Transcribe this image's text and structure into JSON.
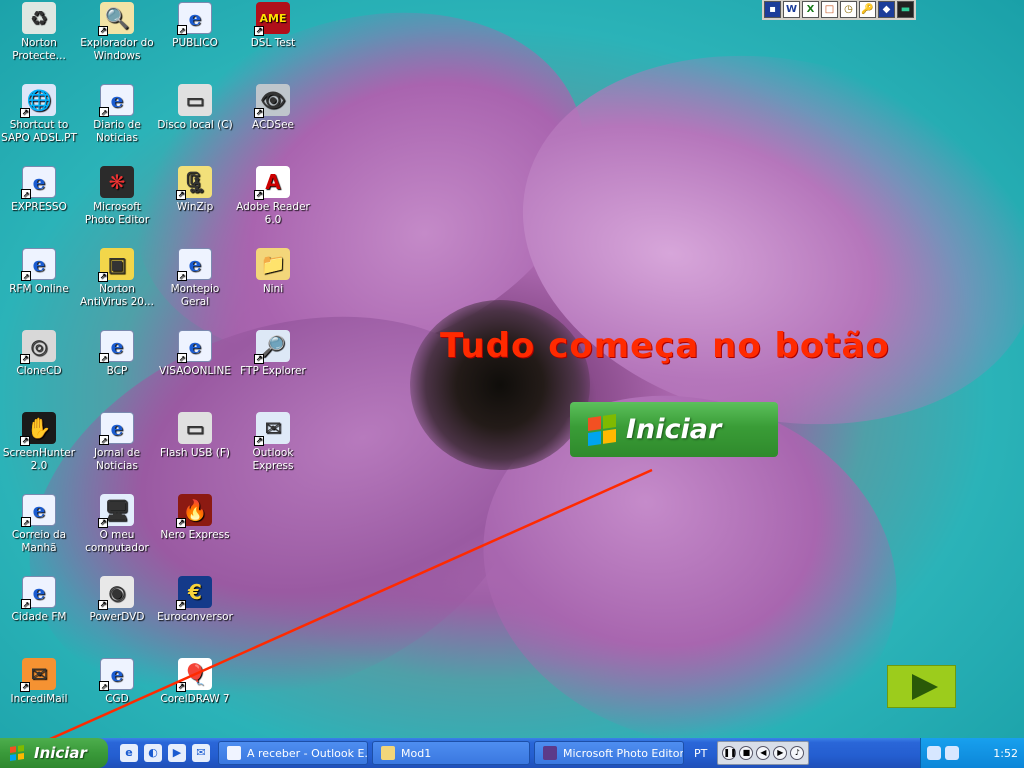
{
  "desktop": {
    "icons": [
      {
        "label": "Norton Protecte...",
        "glyph": "♻",
        "kind": "recycle"
      },
      {
        "label": "Shortcut to SAPO ADSL.PT",
        "glyph": "🌐",
        "kind": "network"
      },
      {
        "label": "EXPRESSO",
        "glyph": "e",
        "kind": "ie"
      },
      {
        "label": "RFM Online",
        "glyph": "e",
        "kind": "ie"
      },
      {
        "label": "CloneCD",
        "glyph": "◎",
        "kind": "cd"
      },
      {
        "label": "ScreenHunter 2.0",
        "glyph": "✋",
        "kind": "hand"
      },
      {
        "label": "Correio da Manhã",
        "glyph": "e",
        "kind": "ie"
      },
      {
        "label": "Cidade FM",
        "glyph": "e",
        "kind": "ie"
      },
      {
        "label": "IncrediMail",
        "glyph": "✉",
        "kind": "mail"
      },
      {
        "label": "Explorador do Windows",
        "glyph": "🔍",
        "kind": "explorer"
      },
      {
        "label": "Diario de Noticias",
        "glyph": "e",
        "kind": "ie"
      },
      {
        "label": "Microsoft Photo Editor",
        "glyph": "❋",
        "kind": "photo"
      },
      {
        "label": "Norton AntiVirus 20...",
        "glyph": "▣",
        "kind": "norton"
      },
      {
        "label": "BCP",
        "glyph": "e",
        "kind": "ie"
      },
      {
        "label": "Jornal de Noticias",
        "glyph": "e",
        "kind": "ie"
      },
      {
        "label": "O meu computador",
        "glyph": "🖥",
        "kind": "pc"
      },
      {
        "label": "PowerDVD",
        "glyph": "◉",
        "kind": "dvd"
      },
      {
        "label": "CGD",
        "glyph": "e",
        "kind": "ie"
      },
      {
        "label": "PUBLICO",
        "glyph": "e",
        "kind": "ie"
      },
      {
        "label": "Disco local (C)",
        "glyph": "▭",
        "kind": "disk"
      },
      {
        "label": "WinZip",
        "glyph": "🗜",
        "kind": "zip"
      },
      {
        "label": "Montepio Geral",
        "glyph": "e",
        "kind": "ie"
      },
      {
        "label": "VISAOONLINE",
        "glyph": "e",
        "kind": "ie"
      },
      {
        "label": "Flash USB (F)",
        "glyph": "▭",
        "kind": "disk"
      },
      {
        "label": "Nero Express",
        "glyph": "🔥",
        "kind": "nero"
      },
      {
        "label": "Euroconversor",
        "glyph": "€",
        "kind": "euro"
      },
      {
        "label": "CorelDRAW 7",
        "glyph": "🎈",
        "kind": "corel"
      },
      {
        "label": "DSL Test",
        "glyph": "AME",
        "kind": "dsl"
      },
      {
        "label": "ACDSee",
        "glyph": "👁",
        "kind": "acdsee"
      },
      {
        "label": "Adobe Reader 6.0",
        "glyph": "A",
        "kind": "adobe"
      },
      {
        "label": "Nini",
        "glyph": "📁",
        "kind": "folder"
      },
      {
        "label": "FTP Explorer",
        "glyph": "🔎",
        "kind": "ftp"
      },
      {
        "label": "Outlook Express",
        "glyph": "✉",
        "kind": "outlook"
      }
    ]
  },
  "top_toolbar": {
    "buttons": [
      "▪",
      "W",
      "X",
      "□",
      "◷",
      "🔑",
      "◆",
      "▬"
    ]
  },
  "overlay": {
    "headline": "Tudo começa no botão",
    "big_start_label": "Iniciar"
  },
  "taskbar": {
    "start_label": "Iniciar",
    "tasks": [
      {
        "label": "A receber - Outlook E..."
      },
      {
        "label": "Mod1"
      },
      {
        "label": "Microsoft Photo Editor"
      }
    ],
    "language": "PT",
    "clock": "1:52"
  },
  "colors": {
    "headline": "#ff2a00",
    "start_green": "#3a9a3a",
    "taskbar_blue": "#245ed0",
    "arrow_red": "#ff2a00"
  }
}
